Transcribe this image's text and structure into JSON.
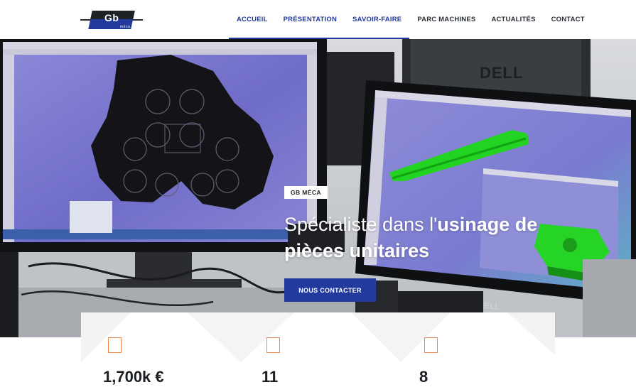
{
  "logo": {
    "main": "Gb",
    "sub": "méca"
  },
  "nav": [
    {
      "label": "ACCUEIL",
      "active": true
    },
    {
      "label": "PRÉSENTATION",
      "active": true
    },
    {
      "label": "SAVOIR-FAIRE",
      "active": true
    },
    {
      "label": "PARC MACHINES",
      "active": false
    },
    {
      "label": "ACTUALITÉS",
      "active": false
    },
    {
      "label": "CONTACT",
      "active": false
    }
  ],
  "hero": {
    "tag": "GB MÉCA",
    "headline_light": "Spécialiste dans l'",
    "headline_bold_1": "usinage de",
    "headline_bold_2": "pièces unitaires",
    "cta": "NOUS CONTACTER",
    "monitor_brand": "DELL"
  },
  "stats": [
    {
      "icon": "square-outline-icon",
      "value": "1,700k €"
    },
    {
      "icon": "square-outline-icon",
      "value": "11"
    },
    {
      "icon": "square-outline-icon",
      "value": "8"
    }
  ],
  "colors": {
    "brand_blue": "#223a9c",
    "accent_orange": "#f0884f",
    "cad_green": "#1fd11f"
  }
}
